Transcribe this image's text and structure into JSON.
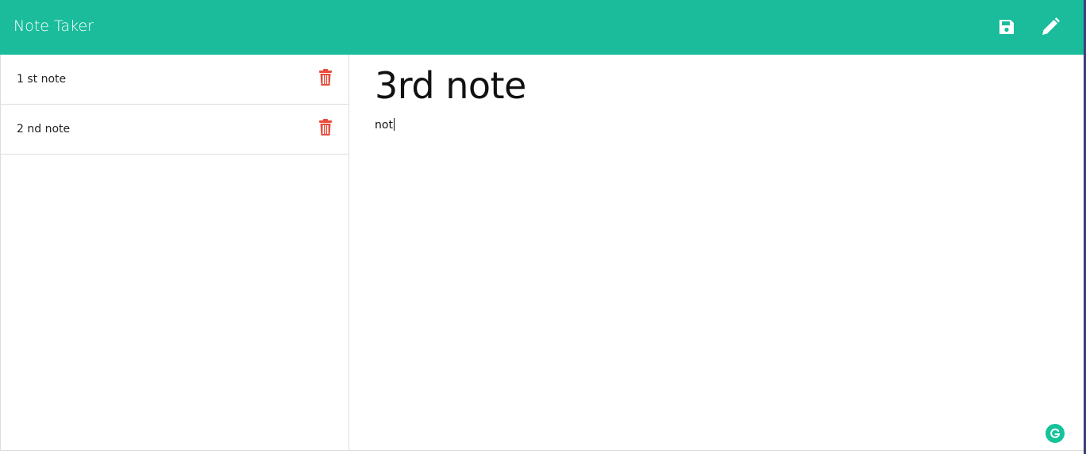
{
  "app": {
    "brand": "Note Taker",
    "accent_color": "#1abc9c",
    "delete_color": "#e74c3c"
  },
  "toolbar": {
    "save_icon": "save-icon",
    "edit_icon": "pencil-icon"
  },
  "notes": [
    {
      "title": "1 st note",
      "delete_icon": "trash-icon"
    },
    {
      "title": "2 nd note",
      "delete_icon": "trash-icon"
    }
  ],
  "editor": {
    "title": "3rd note",
    "body": "not"
  },
  "extensions": {
    "grammarly_icon": "grammarly-icon"
  }
}
